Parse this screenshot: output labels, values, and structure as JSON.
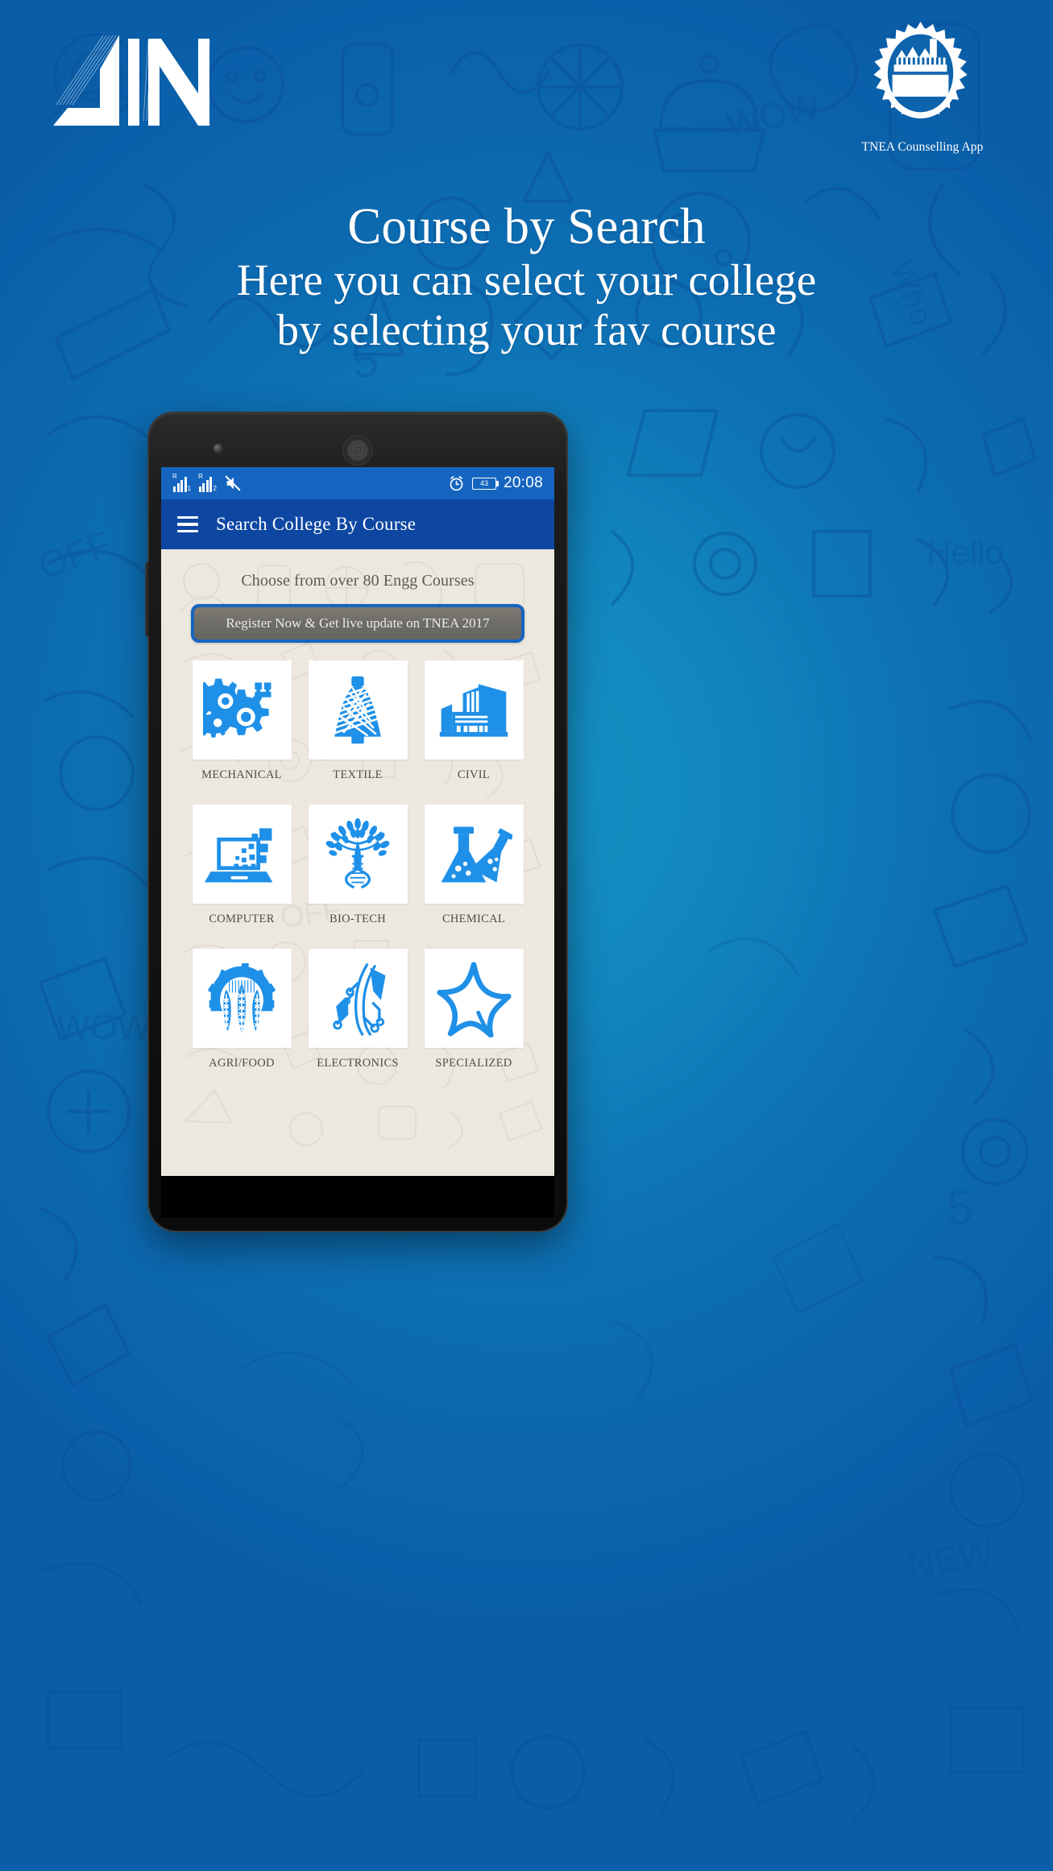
{
  "brand": {
    "logo_name": "ain-logo",
    "emblem_name": "tnea-gear-emblem",
    "emblem_caption": "TNEA Counselling App"
  },
  "headline": {
    "line1": "Course by Search",
    "line2": "Here you can select your college",
    "line3": "by selecting your fav course"
  },
  "phone": {
    "statusbar": {
      "sim1_roaming": "R",
      "sim1_index": "1",
      "sim2_roaming": "R",
      "sim2_index": "2",
      "mute_icon": "mute-icon",
      "alarm_icon": "alarm-clock-icon",
      "battery_level": "43",
      "time": "20:08"
    },
    "appbar": {
      "menu_icon": "hamburger-menu-icon",
      "title": "Search College By Course"
    },
    "content": {
      "subtitle": "Choose from over 80 Engg Courses",
      "register_button": "Register Now & Get live update on TNEA 2017",
      "courses": [
        {
          "label": "MECHANICAL",
          "icon": "gears-icon"
        },
        {
          "label": "TEXTILE",
          "icon": "yarn-spool-icon"
        },
        {
          "label": "CIVIL",
          "icon": "buildings-icon"
        },
        {
          "label": "COMPUTER",
          "icon": "laptop-icon"
        },
        {
          "label": "BIO-TECH",
          "icon": "dna-tree-icon"
        },
        {
          "label": "CHEMICAL",
          "icon": "flasks-icon"
        },
        {
          "label": "AGRI/FOOD",
          "icon": "gear-wheat-icon"
        },
        {
          "label": "ELECTRONICS",
          "icon": "circuit-icon"
        },
        {
          "label": "SPECIALIZED",
          "icon": "star-icon"
        }
      ]
    }
  },
  "colors": {
    "background_blue": "#0d6fb3",
    "statusbar_blue": "#1565c0",
    "appbar_blue": "#0d47a1",
    "icon_blue": "#1f90e8",
    "content_beige": "#ece8df",
    "button_gray": "#706e68"
  }
}
